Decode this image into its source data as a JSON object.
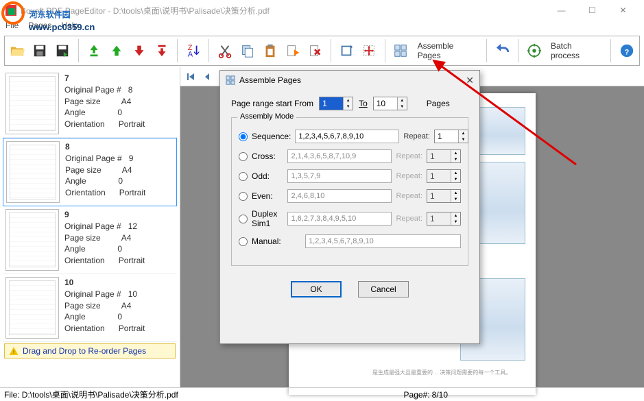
{
  "window": {
    "title": "Boxoft PDF PageEditor - D:\\tools\\桌面\\说明书\\Palisade\\决策分析.pdf",
    "min": "—",
    "max": "☐",
    "close": "✕"
  },
  "menu": {
    "file": "File",
    "pages": "Pages",
    "help": "Help"
  },
  "toolbar": {
    "assemble": "Assemble Pages",
    "batch": "Batch process"
  },
  "thumbs": [
    {
      "num": "7",
      "orig": "Original Page #",
      "origv": "8",
      "ps": "Page size",
      "psv": "A4",
      "an": "Angle",
      "anv": "0",
      "or": "Orientation",
      "orv": "Portrait"
    },
    {
      "num": "8",
      "orig": "Original Page #",
      "origv": "9",
      "ps": "Page size",
      "psv": "A4",
      "an": "Angle",
      "anv": "0",
      "or": "Orientation",
      "orv": "Portrait"
    },
    {
      "num": "9",
      "orig": "Original Page #",
      "origv": "12",
      "ps": "Page size",
      "psv": "A4",
      "an": "Angle",
      "anv": "0",
      "or": "Orientation",
      "orv": "Portrait"
    },
    {
      "num": "10",
      "orig": "Original Page #",
      "origv": "10",
      "ps": "Page size",
      "psv": "A4",
      "an": "Angle",
      "anv": "0",
      "or": "Orientation",
      "orv": "Portrait"
    }
  ],
  "draghint": "Drag and Drop to Re-order Pages",
  "status": {
    "file_label": "File:",
    "file": "D:\\tools\\桌面\\说明书\\Palisade\\决策分析.pdf",
    "page_label": "Page#:",
    "page": "8/10"
  },
  "dialog": {
    "title": "Assemble Pages",
    "range_label": "Page range start From",
    "from": "1",
    "to_label": "To",
    "to": "10",
    "pages_label": "Pages",
    "group": "Assembly Mode",
    "modes": [
      {
        "key": "sequence",
        "label": "Sequence:",
        "seq": "1,2,3,4,5,6,7,8,9,10",
        "rep": "Repeat:",
        "repv": "1",
        "checked": true,
        "enabled": true
      },
      {
        "key": "cross",
        "label": "Cross:",
        "seq": "2,1,4,3,6,5,8,7,10,9",
        "rep": "Repeat:",
        "repv": "1",
        "checked": false,
        "enabled": false
      },
      {
        "key": "odd",
        "label": "Odd:",
        "seq": "1,3,5,7,9",
        "rep": "Repeat:",
        "repv": "1",
        "checked": false,
        "enabled": false
      },
      {
        "key": "even",
        "label": "Even:",
        "seq": "2,4,6,8,10",
        "rep": "Repeat:",
        "repv": "1",
        "checked": false,
        "enabled": false
      },
      {
        "key": "duplex",
        "label": "Duplex Sim1",
        "seq": "1,6,2,7,3,8,4,9,5,10",
        "rep": "Repeat:",
        "repv": "1",
        "checked": false,
        "enabled": false
      },
      {
        "key": "manual",
        "label": "Manual:",
        "seq": "1,2,3,4,5,6,7,8,9,10",
        "rep": "",
        "repv": "",
        "checked": false,
        "enabled": false
      }
    ],
    "ok": "OK",
    "cancel": "Cancel"
  },
  "watermark": {
    "main": "河东软件园",
    "sub": "www.pc0359.cn"
  }
}
